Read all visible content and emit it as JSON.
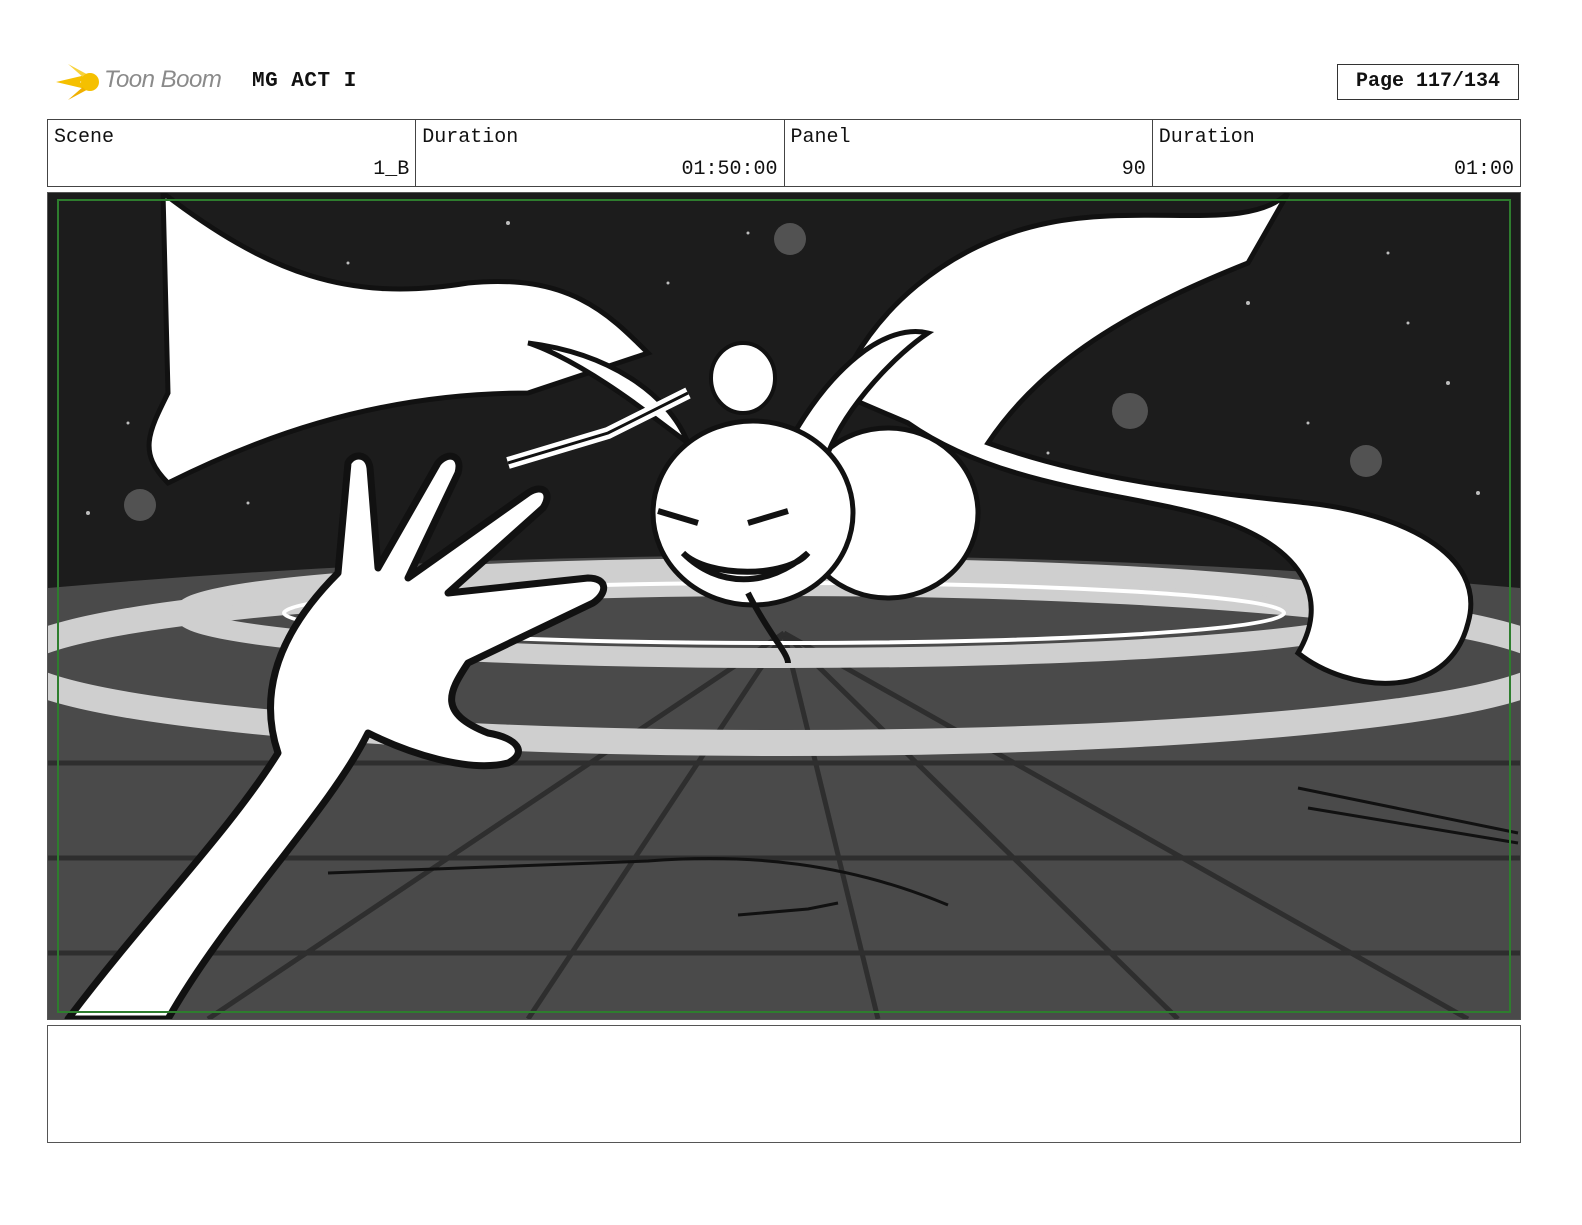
{
  "header": {
    "brand": "Toon Boom",
    "project": "MG ACT I",
    "page": "Page 117/134"
  },
  "info": {
    "scene_label": "Scene",
    "scene_value": "1_B",
    "duration_label": "Duration",
    "duration_value": "01:50:00",
    "panel_label": "Panel",
    "panel_value": "90",
    "panel_duration_label": "Duration",
    "panel_duration_value": "01:00"
  },
  "colors": {
    "logo_star": "#f5c000",
    "safe_frame": "#2e7d2e",
    "space": "#1c1c1c",
    "floor": "#4a4a4a",
    "ring": "#cfcfcf"
  }
}
